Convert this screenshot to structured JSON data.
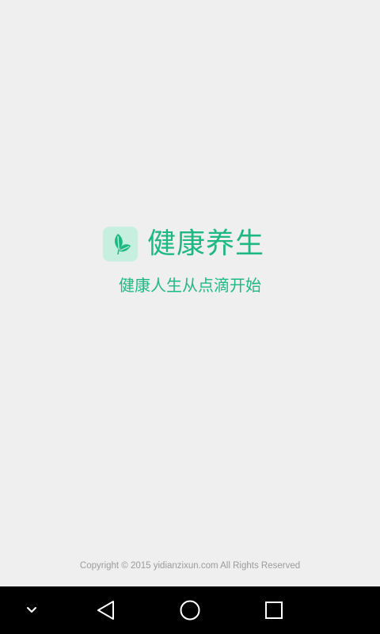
{
  "app": {
    "name": "健康养生",
    "slogan": "健康人生从点滴开始",
    "copyright": "Copyright © 2015 yidianzixun.com All Rights Reserved"
  },
  "icons": {
    "logo": "leaf-icon",
    "nav_hide": "chevron-down-icon",
    "nav_back": "back-triangle-icon",
    "nav_home": "home-circle-icon",
    "nav_recent": "recent-apps-square-icon"
  },
  "colors": {
    "brand": "#1fb883",
    "logo_bg": "#c7efe0",
    "background": "#efefef",
    "copyright_text": "#9b9b9b",
    "nav_bar": "#000000",
    "nav_icon": "#ffffff"
  }
}
